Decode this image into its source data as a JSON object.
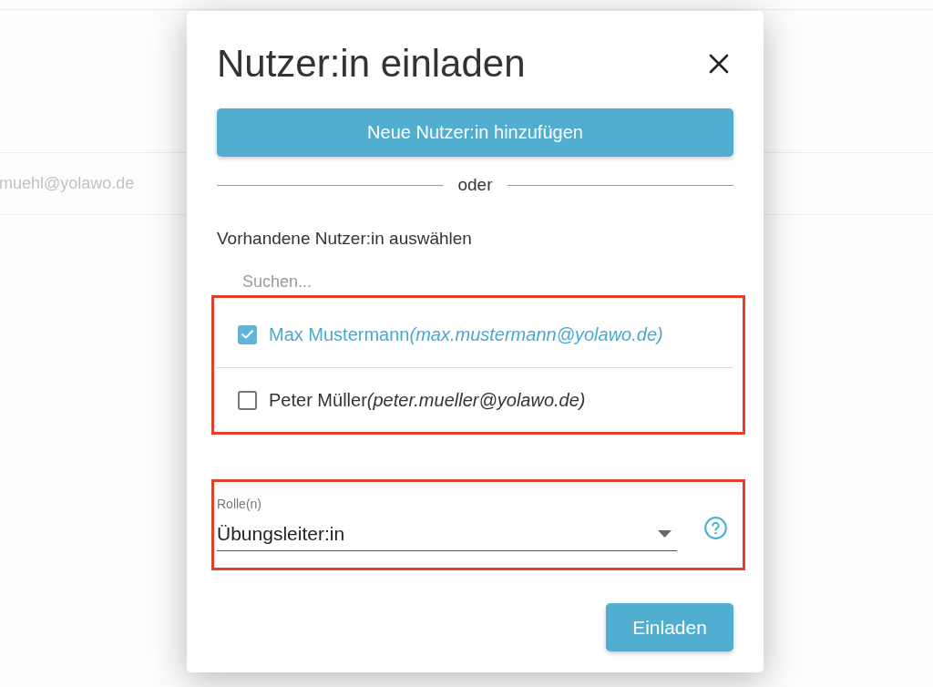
{
  "background": {
    "email": "muehl@yolawo.de"
  },
  "dialog": {
    "title": "Nutzer:in einladen",
    "new_user_button": "Neue Nutzer:in hinzufügen",
    "divider": "oder",
    "existing_label": "Vorhandene Nutzer:in auswählen",
    "search": {
      "placeholder": "Suchen..."
    },
    "users": [
      {
        "name": "Max Mustermann",
        "email": "(max.mustermann@yolawo.de)",
        "checked": true
      },
      {
        "name": "Peter Müller",
        "email": "(peter.mueller@yolawo.de)",
        "checked": false
      }
    ],
    "role": {
      "label": "Rolle(n)",
      "value": "Übungsleiter:in"
    },
    "invite_button": "Einladen"
  }
}
